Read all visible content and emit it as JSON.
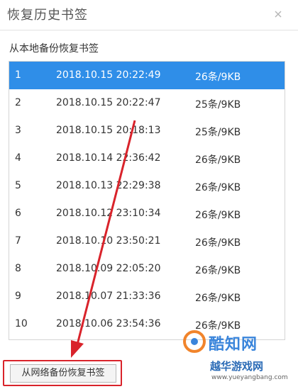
{
  "dialog": {
    "title": "恢复历史书签",
    "close_symbol": "×",
    "section_label": "从本地备份恢复书签",
    "network_restore_label": "从网络备份恢复书签"
  },
  "backups": [
    {
      "index": "1",
      "datetime": "2018.10.15 20:22:49",
      "size": "26条/9KB",
      "selected": true
    },
    {
      "index": "2",
      "datetime": "2018.10.15 20:22:47",
      "size": "25条/9KB",
      "selected": false
    },
    {
      "index": "3",
      "datetime": "2018.10.15 20:18:13",
      "size": "25条/9KB",
      "selected": false
    },
    {
      "index": "4",
      "datetime": "2018.10.14 22:36:42",
      "size": "26条/9KB",
      "selected": false
    },
    {
      "index": "5",
      "datetime": "2018.10.13 22:29:38",
      "size": "26条/9KB",
      "selected": false
    },
    {
      "index": "6",
      "datetime": "2018.10.12 23:10:34",
      "size": "26条/9KB",
      "selected": false
    },
    {
      "index": "7",
      "datetime": "2018.10.10 23:50:21",
      "size": "26条/9KB",
      "selected": false
    },
    {
      "index": "8",
      "datetime": "2018.10.09 22:05:20",
      "size": "26条/9KB",
      "selected": false
    },
    {
      "index": "9",
      "datetime": "2018.10.07 21:33:36",
      "size": "26条/9KB",
      "selected": false
    },
    {
      "index": "10",
      "datetime": "2018.10.06 23:54:36",
      "size": "26条/9KB",
      "selected": false
    }
  ],
  "watermark": {
    "name": "酷知网",
    "name2": "越华游戏网",
    "url": "www.yueyangbang.com"
  },
  "colors": {
    "selected_row": "#2f8ee8",
    "annotation_red": "#d9232b",
    "watermark_blue": "#2a7bd8"
  }
}
